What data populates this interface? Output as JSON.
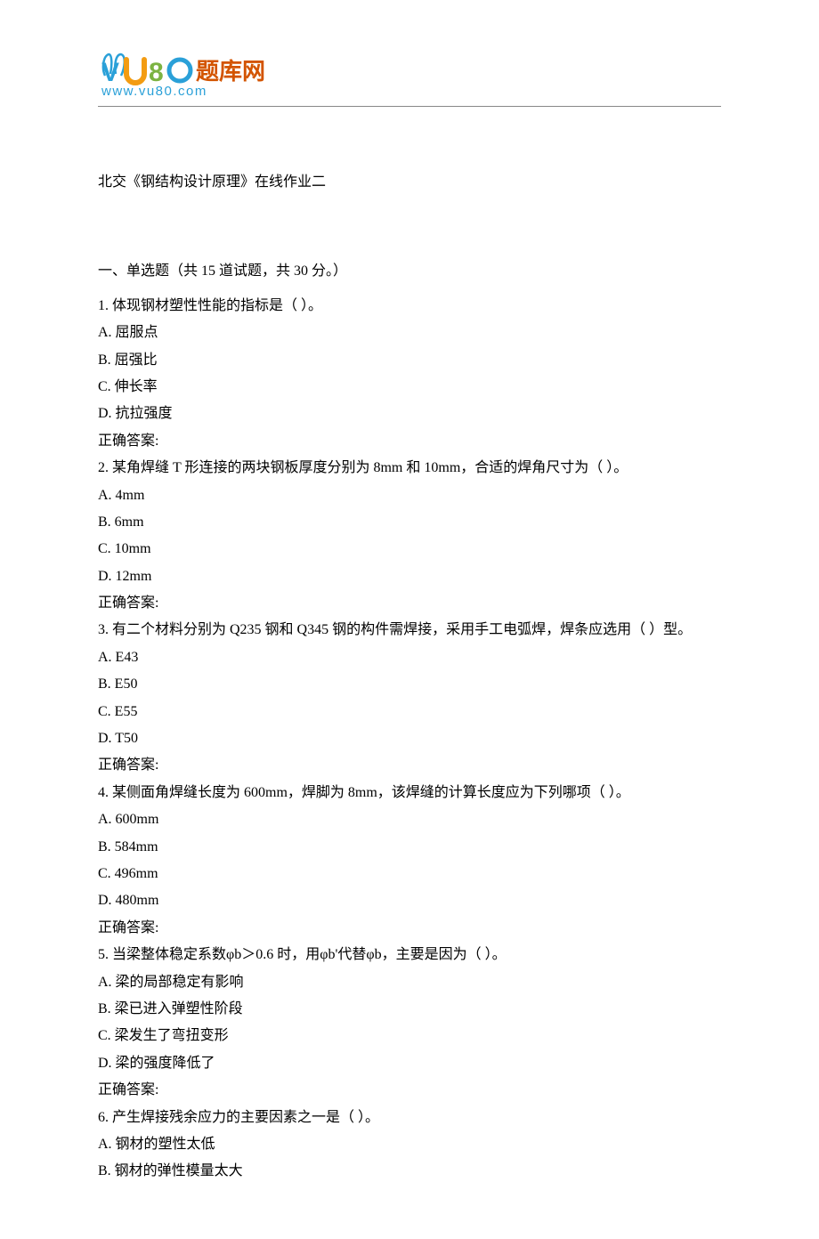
{
  "logo": {
    "brand_text": "题库网",
    "url_text": "www.vu80.com"
  },
  "doc_title": "北交《钢结构设计原理》在线作业二",
  "section1": {
    "heading": "一、单选题（共 15 道试题，共 30 分。）",
    "questions": [
      {
        "stem": "1.   体现钢材塑性性能的指标是（ ）。",
        "options": [
          "A. 屈服点",
          "B. 屈强比",
          "C. 伸长率",
          "D. 抗拉强度"
        ],
        "answer_label": "正确答案:"
      },
      {
        "stem": "2.   某角焊缝 T 形连接的两块钢板厚度分别为 8mm 和 10mm，合适的焊角尺寸为（ ）。",
        "options": [
          "A. 4mm",
          "B. 6mm",
          "C. 10mm",
          "D. 12mm"
        ],
        "answer_label": "正确答案:"
      },
      {
        "stem": "3.   有二个材料分别为 Q235 钢和 Q345 钢的构件需焊接，采用手工电弧焊，焊条应选用（ ）型。",
        "options": [
          "A. E43",
          "B. E50",
          "C. E55",
          "D. T50"
        ],
        "answer_label": "正确答案:"
      },
      {
        "stem": "4.   某侧面角焊缝长度为 600mm，焊脚为 8mm，该焊缝的计算长度应为下列哪项（ ）。",
        "options": [
          "A. 600mm",
          "B. 584mm",
          "C. 496mm",
          "D. 480mm"
        ],
        "answer_label": "正确答案:"
      },
      {
        "stem": "5.   当梁整体稳定系数φb＞0.6 时，用φb'代替φb，主要是因为（ ）。",
        "options": [
          "A. 梁的局部稳定有影响",
          "B. 梁已进入弹塑性阶段",
          "C. 梁发生了弯扭变形",
          "D. 梁的强度降低了"
        ],
        "answer_label": "正确答案:"
      },
      {
        "stem": "6.   产生焊接残余应力的主要因素之一是（ ）。",
        "options": [
          "A. 钢材的塑性太低",
          "B. 钢材的弹性模量太大"
        ],
        "answer_label": ""
      }
    ]
  }
}
